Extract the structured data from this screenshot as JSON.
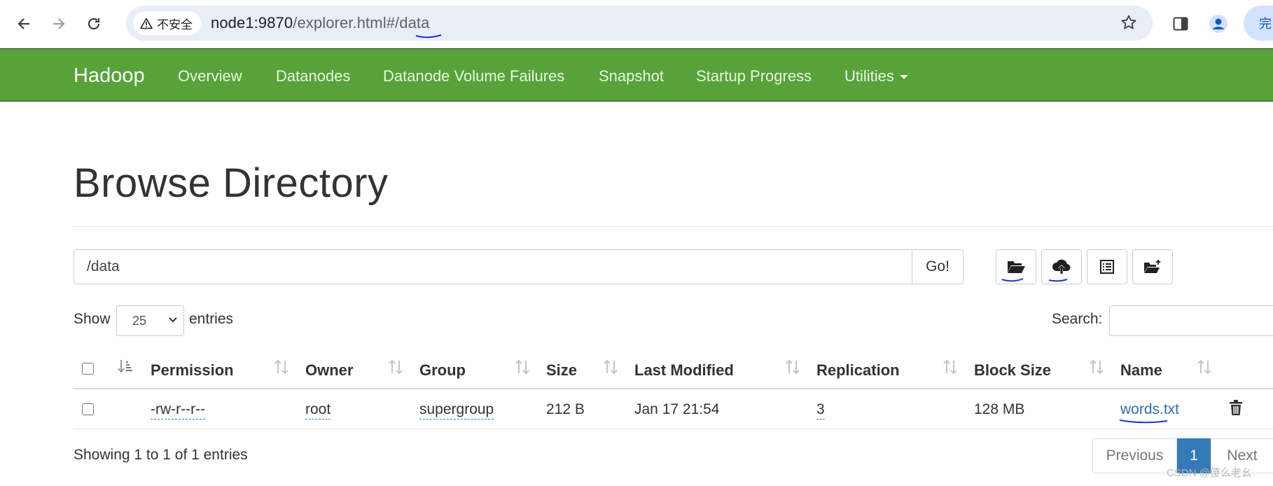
{
  "browser": {
    "security_label": "不安全",
    "url_host": "node1:9870",
    "url_path": "/explorer.html#/data",
    "finish_label": "完",
    "icons": [
      "back-arrow-icon",
      "forward-arrow-icon",
      "reload-icon",
      "warning-icon",
      "star-icon",
      "side-panel-icon",
      "profile-icon"
    ]
  },
  "navbar": {
    "brand": "Hadoop",
    "links": [
      "Overview",
      "Datanodes",
      "Datanode Volume Failures",
      "Snapshot",
      "Startup Progress",
      "Utilities"
    ],
    "color": "#57a339"
  },
  "page": {
    "title": "Browse Directory",
    "path_value": "/data",
    "go_label": "Go!",
    "action_icons": [
      "folder-open-icon",
      "cloud-upload-icon",
      "list-icon",
      "folder-move-icon"
    ]
  },
  "table_controls": {
    "show_label": "Show",
    "page_length": "25",
    "entries_label": "entries",
    "search_label": "Search:",
    "search_value": ""
  },
  "table": {
    "columns": [
      "Permission",
      "Owner",
      "Group",
      "Size",
      "Last Modified",
      "Replication",
      "Block Size",
      "Name"
    ],
    "rows": [
      {
        "permission": "-rw-r--r--",
        "owner": "root",
        "group": "supergroup",
        "size": "212 B",
        "last_modified": "Jan 17 21:54",
        "replication": "3",
        "block_size": "128 MB",
        "name": "words.txt"
      }
    ]
  },
  "footer": {
    "info": "Showing 1 to 1 of 1 entries",
    "previous": "Previous",
    "current_page": "1",
    "next": "Next",
    "accent": "#337ab7"
  },
  "watermark": "CSDN @傻么老幺"
}
